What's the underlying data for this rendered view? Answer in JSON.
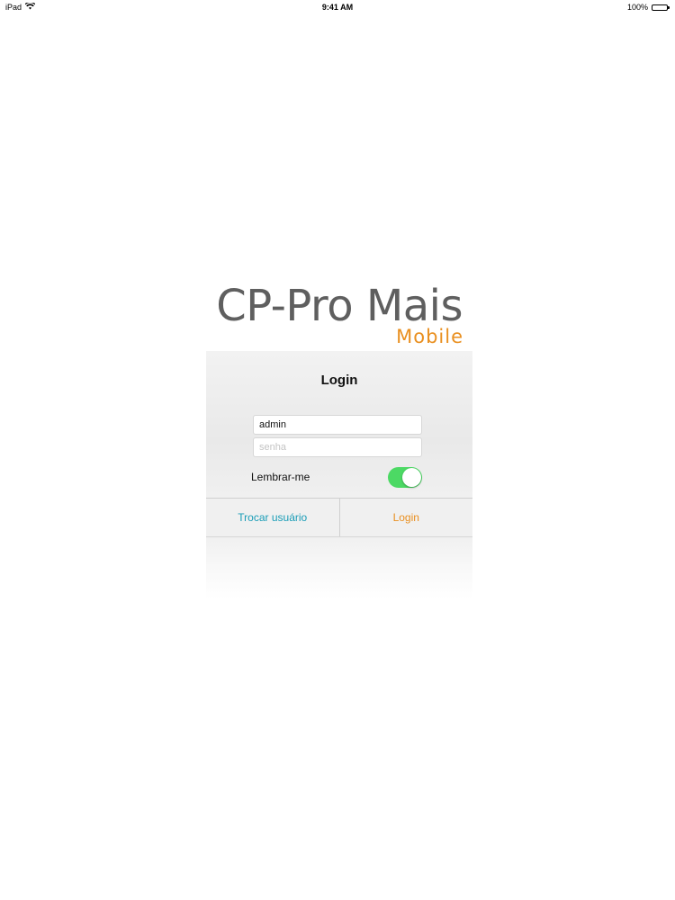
{
  "status_bar": {
    "device": "iPad",
    "time": "9:41 AM",
    "battery": "100%",
    "battery_level": 1.0,
    "icons": [
      "wifi-icon",
      "battery-icon"
    ]
  },
  "logo": {
    "title": "CP-Pro Mais",
    "subtitle": "Mobile"
  },
  "login": {
    "title": "Login",
    "username_value": "admin",
    "password_placeholder": "senha",
    "remember_label": "Lembrar-me",
    "remember_enabled": true,
    "switch_user_label": "Trocar usuário",
    "login_label": "Login"
  },
  "colors": {
    "accent_orange": "#e98f1f",
    "accent_teal": "#1a9db7",
    "toggle_on": "#4cd964",
    "logo_gray": "#5f5f5f"
  }
}
